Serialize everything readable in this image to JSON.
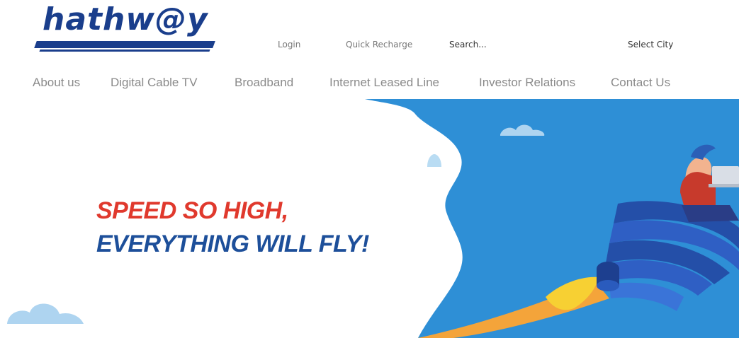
{
  "brand": {
    "logo_text": "hathw@y"
  },
  "utility_bar": {
    "login": "Login",
    "quick_recharge": "Quick Recharge",
    "search_placeholder": "Search...",
    "select_city": "Select City"
  },
  "nav": {
    "items": [
      {
        "label": "About us"
      },
      {
        "label": "Digital Cable TV"
      },
      {
        "label": "Broadband"
      },
      {
        "label": "Internet Leased Line"
      },
      {
        "label": "Investor Relations"
      },
      {
        "label": "Contact Us"
      }
    ]
  },
  "hero": {
    "headline_line1": "SPEED SO HIGH,",
    "headline_line2": "EVERYTHING WILL FLY!",
    "colors": {
      "headline_red": "#e0392d",
      "headline_blue": "#1d4f9a",
      "sky_blue": "#2e8fd6",
      "cloud": "#aed4f0"
    },
    "illustration": [
      "cloud-icon",
      "hot-air-balloon-icon",
      "wifi-rocket-icon",
      "person-with-laptop-icon"
    ]
  }
}
